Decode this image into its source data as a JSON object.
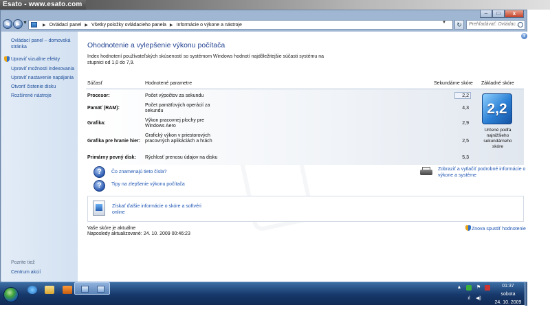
{
  "banner": {
    "text": "Esato - www.esato.com"
  },
  "window": {
    "controls": {
      "minimize": "–",
      "maximize": "□",
      "close": "x"
    }
  },
  "nav": {
    "back": "◄",
    "forward": "►",
    "breadcrumb": [
      "Ovládací panel",
      "Všetky položky ovládacieho panela",
      "Informácie o výkone a nástroje"
    ],
    "search_placeholder": "Prehľadávať: Ovládac..."
  },
  "sidebar": {
    "items": [
      {
        "label": "Ovládací panel – domovská stránka"
      },
      {
        "label": "Upraviť vizuálne efekty",
        "icon": "shield-icon"
      },
      {
        "label": "Upraviť možnosti indexovania"
      },
      {
        "label": "Upraviť nastavenie napájania"
      },
      {
        "label": "Otvoriť čistenie disku"
      },
      {
        "label": "Rozšírené nástroje"
      }
    ],
    "see_also_title": "Pozrite tiež",
    "see_also_items": [
      {
        "label": "Centrum akcií"
      }
    ]
  },
  "main": {
    "title": "Ohodnotenie a vylepšenie výkonu počítača",
    "description": "Index hodnotení používateľských skúseností so systémom Windows hodnotí najdôležitejšie súčasti systému na stupnici od 1,0 do 7,9."
  },
  "table": {
    "headers": {
      "component": "Súčasť",
      "param": "Hodnotené parametre",
      "subscore": "Sekundárne skóre",
      "base": "Základné skóre"
    },
    "rows": [
      {
        "component": "Procesor:",
        "param": "Počet výpočtov za sekundu",
        "subscore": "2,2"
      },
      {
        "component": "Pamäť (RAM):",
        "param": "Počet pamäťových operácií za sekundu",
        "subscore": "4,3"
      },
      {
        "component": "Grafika:",
        "param": "Výkon pracovnej plochy pre Windows Aero",
        "subscore": "2,9"
      },
      {
        "component": "Grafika pre hranie hier:",
        "param": "Grafický výkon v priestorových pracovných aplikáciách a hrách",
        "subscore": "2,5"
      },
      {
        "component": "Primárny pevný disk:",
        "param": "Rýchlosť prenosu údajov na disku",
        "subscore": "5,3"
      }
    ],
    "base_score": "2,2",
    "base_caption": "Určené podľa najnižšieho sekundárneho skóre"
  },
  "help": {
    "what_mean": "Čo znamenajú tieto čísla?",
    "tips": "Tipy na zlepšenie výkonu počítača",
    "print": "Zobraziť a vytlačiť podrobné informácie o výkone a systéme",
    "more_info": "Získať ďalšie informácie o skóre a softvéri online"
  },
  "status": {
    "current": "Vaše skóre je aktuálne",
    "updated": "Naposledy aktualizované: 24. 10. 2009 00:46:23",
    "rerun": "Znova spustiť hodnotenie"
  },
  "taskbar": {
    "time": "01:37",
    "day": "sobota",
    "date": "24. 10. 2009"
  }
}
